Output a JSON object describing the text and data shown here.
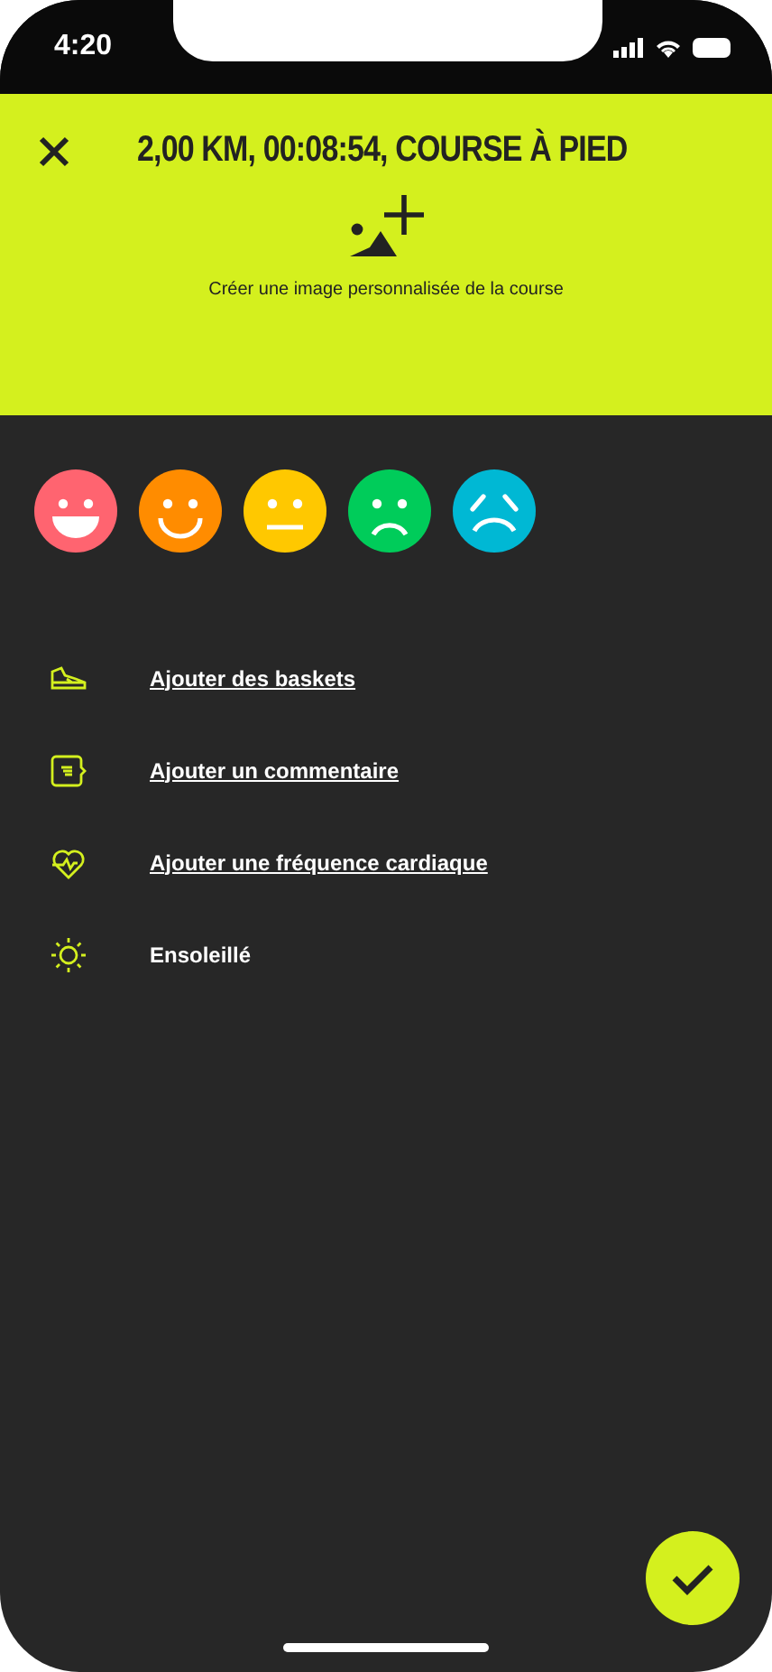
{
  "status_bar": {
    "time": "4:20"
  },
  "header": {
    "title": "2,00 KM, 00:08:54, COURSE À PIED",
    "image_action": "Créer une image personnalisée de la course"
  },
  "moods": [
    {
      "kind": "grin",
      "color": "#ff6470",
      "selected": false
    },
    {
      "kind": "smile",
      "color": "#ff8c00",
      "selected": false
    },
    {
      "kind": "neutral",
      "color": "#ffc800",
      "selected": false
    },
    {
      "kind": "sad",
      "color": "#00cc5a",
      "selected": false
    },
    {
      "kind": "upset",
      "color": "#00b8d4",
      "selected": false
    }
  ],
  "actions": [
    {
      "kind": "shoe",
      "label": "Ajouter des baskets",
      "link": true
    },
    {
      "kind": "comment",
      "label": "Ajouter un commentaire",
      "link": true
    },
    {
      "kind": "heart",
      "label": "Ajouter une fréquence cardiaque",
      "link": true
    },
    {
      "kind": "sun",
      "label": "Ensoleillé",
      "link": false
    }
  ]
}
